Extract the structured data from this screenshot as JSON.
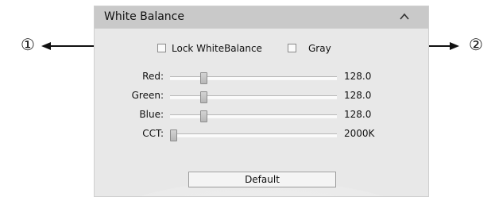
{
  "panel": {
    "title": "White Balance"
  },
  "options": {
    "lock_label": "Lock WhiteBalance",
    "lock_checked": false,
    "gray_label": "Gray",
    "gray_checked": false
  },
  "sliders": [
    {
      "label": "Red:",
      "value": "128.0",
      "fraction": 0.19
    },
    {
      "label": "Green:",
      "value": "128.0",
      "fraction": 0.19
    },
    {
      "label": "Blue:",
      "value": "128.0",
      "fraction": 0.19
    },
    {
      "label": "CCT:",
      "value": "2000K",
      "fraction": 0.0
    }
  ],
  "buttons": {
    "default_label": "Default"
  },
  "callouts": {
    "left": "①",
    "right": "②"
  }
}
